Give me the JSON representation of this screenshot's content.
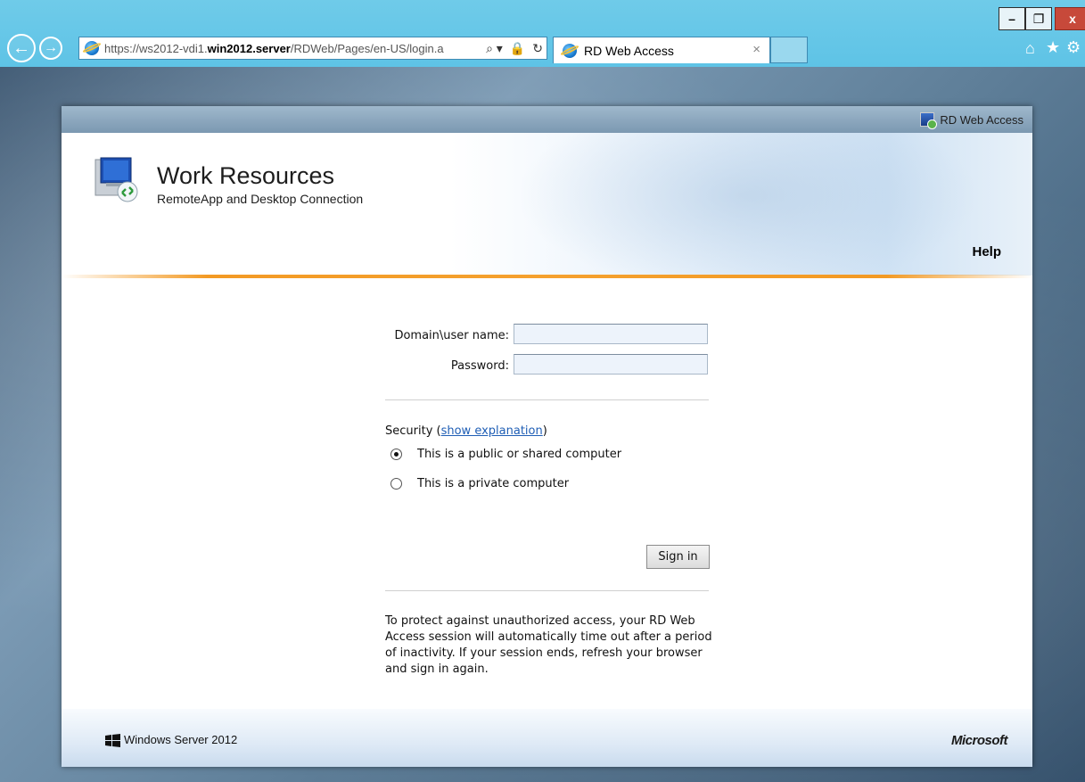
{
  "browser": {
    "url_prefix": "https://ws2012-vdi1.",
    "url_host": "win2012.server",
    "url_path": "/RDWeb/Pages/en-US/login.a",
    "tab_title": "RD Web Access",
    "tab_close": "×",
    "window_controls": {
      "minimize": "–",
      "maximize": "❐",
      "close": "x"
    },
    "nav": {
      "back": "←",
      "forward": "→",
      "search": "⌕ ▾",
      "lock": "🔒",
      "refresh": "↻"
    },
    "toolbar_icons": [
      "home-icon",
      "star-icon",
      "gear-icon"
    ]
  },
  "top_strip": {
    "link_label": "RD Web Access"
  },
  "header": {
    "title": "Work Resources",
    "subtitle": "RemoteApp and Desktop Connection",
    "help_label": "Help"
  },
  "form": {
    "username_label": "Domain\\user name:",
    "username_value": "",
    "password_label": "Password:",
    "password_value": "",
    "security_prefix": "Security (",
    "security_link": "show explanation",
    "security_suffix": ")",
    "radio_options": [
      {
        "label": "This is a public or shared computer",
        "checked": true
      },
      {
        "label": "This is a private computer",
        "checked": false
      }
    ],
    "signin_label": "Sign in",
    "timeout_text": "To protect against unauthorized access, your RD Web Access session will automatically time out after a period of inactivity. If your session ends, refresh your browser and sign in again."
  },
  "footer": {
    "product_label": "Windows Server 2012",
    "vendor_label": "Microsoft"
  },
  "colors": {
    "chrome": "#5ec3e6",
    "accent_orange": "#f39a24",
    "link_blue": "#1f5eb5",
    "close_red": "#c7493a"
  }
}
